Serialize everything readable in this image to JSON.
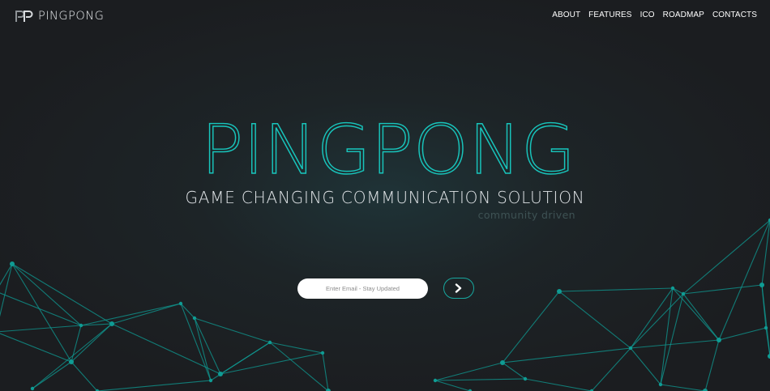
{
  "brand": {
    "name": "PINGPONG",
    "logo_icon": "pp-logo-icon"
  },
  "nav": {
    "items": [
      {
        "label": "ABOUT"
      },
      {
        "label": "FEATURES"
      },
      {
        "label": "ICO"
      },
      {
        "label": "ROADMAP"
      },
      {
        "label": "CONTACTS"
      }
    ]
  },
  "hero": {
    "title": "PINGPONG",
    "subtitle": "GAME CHANGING COMMUNICATION SOLUTION",
    "tagline": "community driven"
  },
  "signup": {
    "email_placeholder": "Enter Email - Stay Updated",
    "email_value": "",
    "submit_icon": "chevron-right-icon"
  },
  "colors": {
    "accent": "#18c5bc",
    "background": "#1c1e21",
    "network_lines": "#0f9c94"
  }
}
